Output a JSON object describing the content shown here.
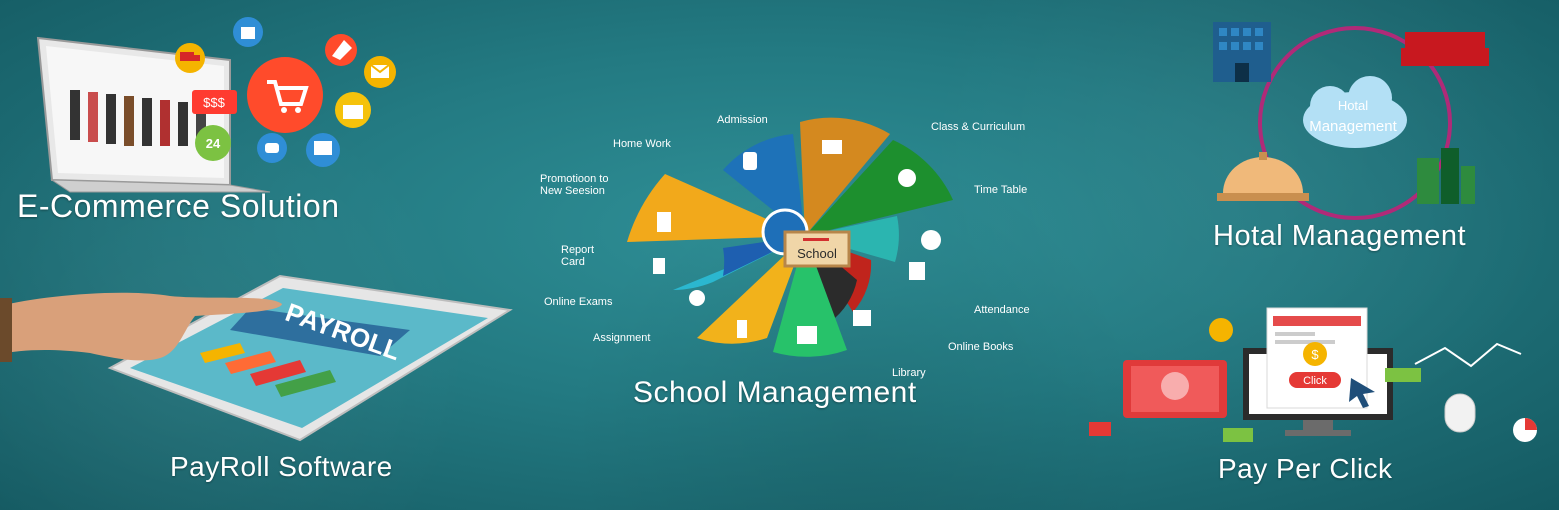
{
  "ecommerce": {
    "title": "E-Commerce Solution",
    "money_label": "$$$",
    "hours_label": "24"
  },
  "payroll": {
    "title": "PayRoll Software",
    "tablet_header": "PAYROLL"
  },
  "school": {
    "title": "School Management",
    "center_label": "School",
    "segments": [
      "Admission",
      "Class & Curriculum",
      "Time Table",
      "Attendance",
      "Online Books",
      "Library",
      "Assignment",
      "Online Exams",
      "Report Card",
      "Promotioon to New Seesion",
      "Home Work"
    ],
    "segment_lines": {
      "report_1": "Report",
      "report_2": "Card",
      "promo_1": "Promotioon to",
      "promo_2": "New Seesion"
    }
  },
  "hotel": {
    "title": "Hotal Management",
    "cloud_line1": "Hotal",
    "cloud_line2": "Management"
  },
  "ppc": {
    "title": "Pay Per Click",
    "click_label": "Click",
    "dollar_sign": "$"
  }
}
